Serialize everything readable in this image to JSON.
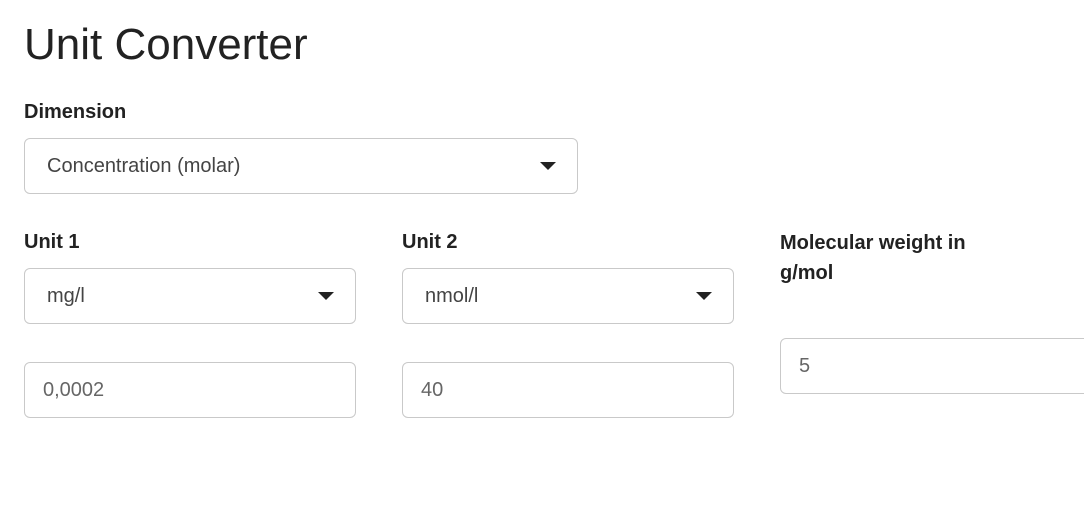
{
  "title": "Unit Converter",
  "dimension": {
    "label": "Dimension",
    "value": "Concentration (molar)"
  },
  "unit1": {
    "label": "Unit 1",
    "value": "mg/l",
    "input_value": "0,0002"
  },
  "unit2": {
    "label": "Unit 2",
    "value": "nmol/l",
    "input_value": "40"
  },
  "molecular_weight": {
    "label": "Molecular weight in g/mol",
    "value": "5"
  }
}
